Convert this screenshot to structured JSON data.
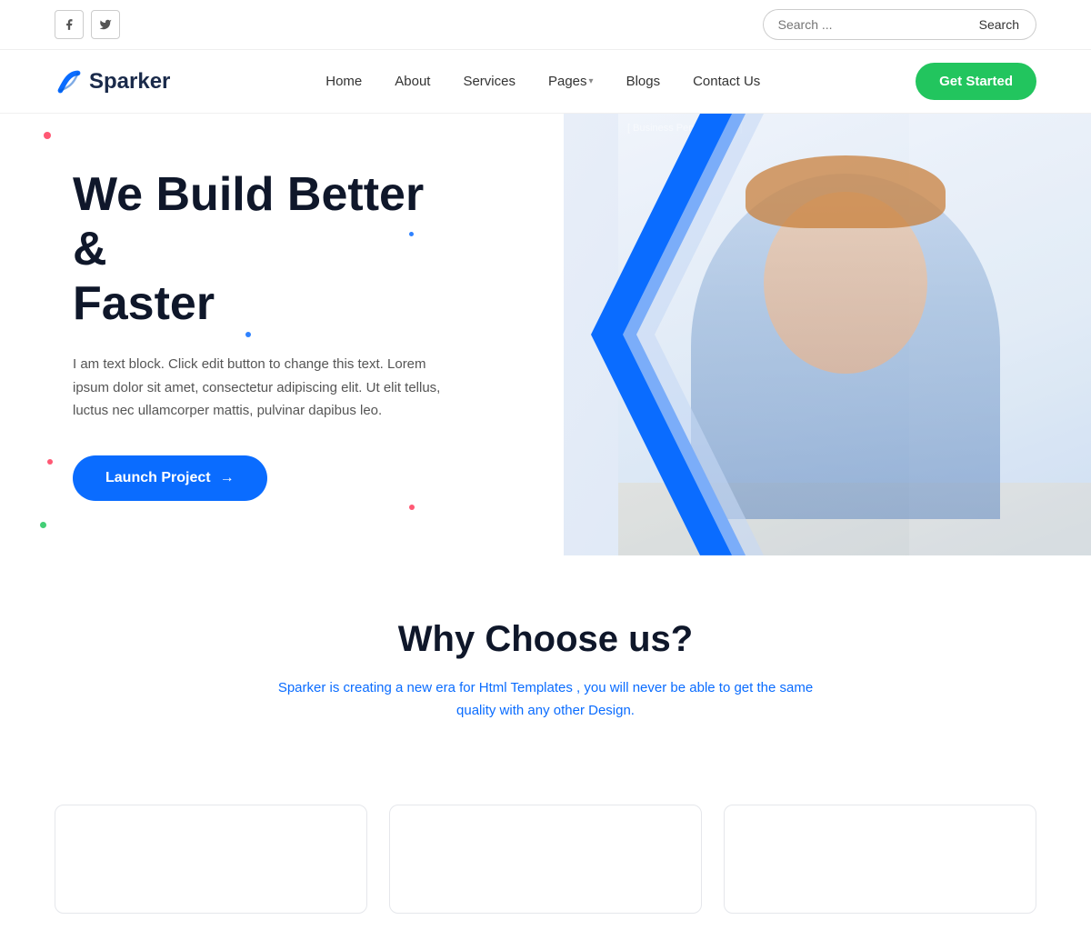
{
  "topbar": {
    "social": {
      "facebook_label": "f",
      "twitter_label": "t"
    },
    "search": {
      "placeholder": "Search ...",
      "button_label": "Search"
    }
  },
  "navbar": {
    "logo_text": "Sparker",
    "nav_items": [
      {
        "label": "Home",
        "has_dropdown": false
      },
      {
        "label": "About",
        "has_dropdown": false
      },
      {
        "label": "Services",
        "has_dropdown": false
      },
      {
        "label": "Pages",
        "has_dropdown": true
      },
      {
        "label": "Blogs",
        "has_dropdown": false
      },
      {
        "label": "Contact Us",
        "has_dropdown": false
      }
    ],
    "cta_label": "Get Started"
  },
  "hero": {
    "title_line1": "We Build Better &",
    "title_line2": "Faster",
    "body_text": "I am text block. Click edit button to change this text. Lorem ipsum dolor sit amet, consectetur adipiscing elit. Ut elit tellus, luctus nec ullamcorper mattis, pulvinar dapibus leo.",
    "cta_label": "Launch Project",
    "cta_arrow": "→"
  },
  "why": {
    "title": "Why Choose us?",
    "description_part1": "Sparker is creating a new era for",
    "highlight": "Html Templates",
    "description_part2": ", you will never be able to get the same quality with any other Design."
  },
  "cards": [
    {
      "label": ""
    },
    {
      "label": ""
    },
    {
      "label": ""
    }
  ],
  "colors": {
    "accent_blue": "#0a6cff",
    "green": "#22c55e",
    "dark": "#0f172a",
    "light_blue_shape": "#e8eef8"
  }
}
